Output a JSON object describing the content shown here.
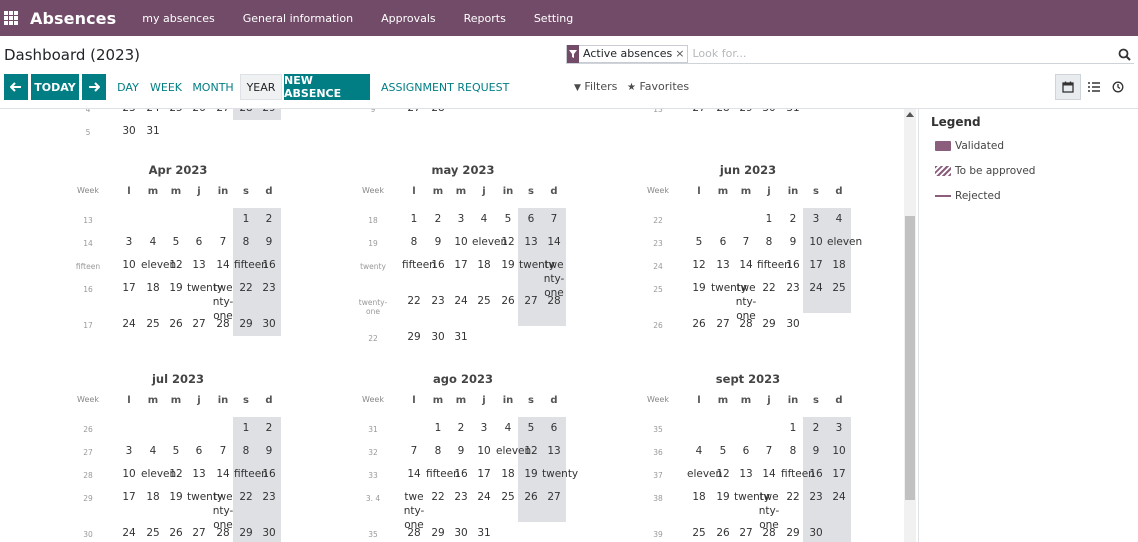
{
  "navbar": {
    "app_title": "Absences",
    "menu": [
      "my absences",
      "General information",
      "Approvals",
      "Reports",
      "Setting"
    ]
  },
  "control_panel": {
    "title": "Dashboard (2023)",
    "search": {
      "facet": "Active absences",
      "facet_remove": "×",
      "placeholder": "Look for..."
    },
    "buttons": {
      "today": "TODAY",
      "scales": [
        "DAY",
        "WEEK",
        "MONTH",
        "YEAR"
      ],
      "active_scale": "YEAR",
      "new_absence": "NEW ABSENCE",
      "assignment_request": "ASSIGNMENT REQUEST"
    },
    "filters": "Filters",
    "favorites": "Favorites",
    "views": [
      "calendar-icon",
      "list-icon",
      "activity-icon"
    ],
    "active_view": "calendar-icon"
  },
  "weekday_headers": [
    "Week",
    "l",
    "m",
    "m",
    "j",
    "in",
    "s",
    "d"
  ],
  "months": [
    {
      "title": "",
      "rows": [
        {
          "week": "4",
          "days": [
            "23",
            "24",
            "25",
            "26",
            "27",
            "28",
            "29"
          ]
        },
        {
          "week": "5",
          "days": [
            "30",
            "31",
            "",
            "",
            "",
            "",
            ""
          ]
        }
      ]
    },
    {
      "title": "",
      "rows": [
        {
          "week": "9",
          "days": [
            "27",
            "28",
            "",
            "",
            "",
            "",
            ""
          ]
        }
      ]
    },
    {
      "title": "",
      "rows": [
        {
          "week": "13",
          "days": [
            "27",
            "28",
            "29",
            "30",
            "31",
            "",
            ""
          ]
        }
      ]
    },
    {
      "title": "Apr 2023",
      "rows": [
        {
          "week": "13",
          "days": [
            "",
            "",
            "",
            "",
            "",
            "1",
            "2"
          ]
        },
        {
          "week": "14",
          "days": [
            "3",
            "4",
            "5",
            "6",
            "7",
            "8",
            "9"
          ]
        },
        {
          "week": "fifteen",
          "days": [
            "10",
            "eleven",
            "12",
            "13",
            "14",
            "fifteen",
            "16"
          ]
        },
        {
          "week": "16",
          "days": [
            "17",
            "18",
            "19",
            "twenty",
            "twenty-one",
            "22",
            "23"
          ]
        },
        {
          "week": "17",
          "days": [
            "24",
            "25",
            "26",
            "27",
            "28",
            "29",
            "30"
          ]
        }
      ]
    },
    {
      "title": "may 2023",
      "rows": [
        {
          "week": "18",
          "days": [
            "1",
            "2",
            "3",
            "4",
            "5",
            "6",
            "7"
          ]
        },
        {
          "week": "19",
          "days": [
            "8",
            "9",
            "10",
            "eleven",
            "12",
            "13",
            "14"
          ]
        },
        {
          "week": "twenty",
          "days": [
            "fifteen",
            "16",
            "17",
            "18",
            "19",
            "twenty",
            "twenty-one"
          ]
        },
        {
          "week": "twenty-one",
          "days": [
            "22",
            "23",
            "24",
            "25",
            "26",
            "27",
            "28"
          ]
        },
        {
          "week": "22",
          "days": [
            "29",
            "30",
            "31",
            "",
            "",
            "",
            ""
          ]
        }
      ]
    },
    {
      "title": "jun 2023",
      "rows": [
        {
          "week": "22",
          "days": [
            "",
            "",
            "",
            "1",
            "2",
            "3",
            "4"
          ]
        },
        {
          "week": "23",
          "days": [
            "5",
            "6",
            "7",
            "8",
            "9",
            "10",
            "eleven"
          ]
        },
        {
          "week": "24",
          "days": [
            "12",
            "13",
            "14",
            "fifteen",
            "16",
            "17",
            "18"
          ]
        },
        {
          "week": "25",
          "days": [
            "19",
            "twenty",
            "twenty-one",
            "22",
            "23",
            "24",
            "25"
          ]
        },
        {
          "week": "26",
          "days": [
            "26",
            "27",
            "28",
            "29",
            "30",
            "",
            ""
          ]
        }
      ]
    },
    {
      "title": "jul 2023",
      "rows": [
        {
          "week": "26",
          "days": [
            "",
            "",
            "",
            "",
            "",
            "1",
            "2"
          ]
        },
        {
          "week": "27",
          "days": [
            "3",
            "4",
            "5",
            "6",
            "7",
            "8",
            "9"
          ]
        },
        {
          "week": "28",
          "days": [
            "10",
            "eleven",
            "12",
            "13",
            "14",
            "fifteen",
            "16"
          ]
        },
        {
          "week": "29",
          "days": [
            "17",
            "18",
            "19",
            "twenty",
            "twenty-one",
            "22",
            "23"
          ]
        },
        {
          "week": "30",
          "days": [
            "24",
            "25",
            "26",
            "27",
            "28",
            "29",
            "30"
          ]
        }
      ]
    },
    {
      "title": "ago 2023",
      "rows": [
        {
          "week": "31",
          "days": [
            "",
            "1",
            "2",
            "3",
            "4",
            "5",
            "6"
          ]
        },
        {
          "week": "32",
          "days": [
            "7",
            "8",
            "9",
            "10",
            "eleven",
            "12",
            "13"
          ]
        },
        {
          "week": "33",
          "days": [
            "14",
            "fifteen",
            "16",
            "17",
            "18",
            "19",
            "twenty"
          ]
        },
        {
          "week": "3. 4",
          "days": [
            "twenty-one",
            "22",
            "23",
            "24",
            "25",
            "26",
            "27"
          ]
        },
        {
          "week": "35",
          "days": [
            "28",
            "29",
            "30",
            "31",
            "",
            "",
            ""
          ]
        }
      ]
    },
    {
      "title": "sept 2023",
      "rows": [
        {
          "week": "35",
          "days": [
            "",
            "",
            "",
            "",
            "1",
            "2",
            "3"
          ]
        },
        {
          "week": "36",
          "days": [
            "4",
            "5",
            "6",
            "7",
            "8",
            "9",
            "10"
          ]
        },
        {
          "week": "37",
          "days": [
            "eleven",
            "12",
            "13",
            "14",
            "fifteen",
            "16",
            "17"
          ]
        },
        {
          "week": "38",
          "days": [
            "18",
            "19",
            "twenty",
            "twenty-one",
            "22",
            "23",
            "24"
          ]
        },
        {
          "week": "39",
          "days": [
            "25",
            "26",
            "27",
            "28",
            "29",
            "30",
            ""
          ]
        }
      ]
    }
  ],
  "legend": {
    "title": "Legend",
    "items": [
      "Validated",
      "To be approved",
      "Rejected"
    ]
  }
}
